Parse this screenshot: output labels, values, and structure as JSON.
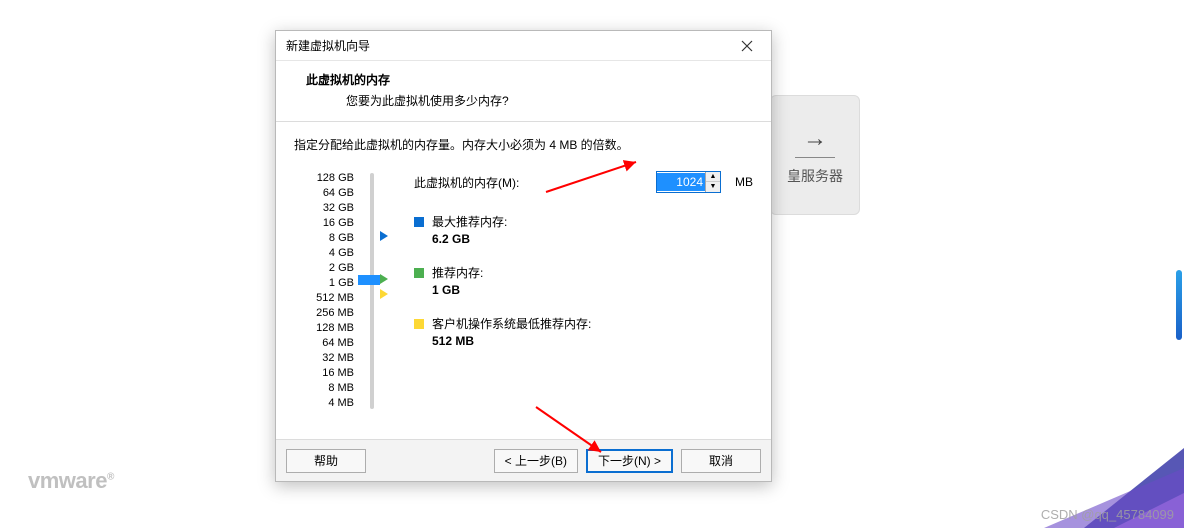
{
  "dialog": {
    "title": "新建虚拟机向导",
    "header_title": "此虚拟机的内存",
    "header_sub": "您要为此虚拟机使用多少内存?",
    "instruction": "指定分配给此虚拟机的内存量。内存大小必须为 4 MB 的倍数。",
    "mem_label": "此虚拟机的内存(M):",
    "mem_value": "1024",
    "mem_unit": "MB",
    "scale": [
      "128 GB",
      "64 GB",
      "32 GB",
      "16 GB",
      "8 GB",
      "4 GB",
      "2 GB",
      "1 GB",
      "512 MB",
      "256 MB",
      "128 MB",
      "64 MB",
      "32 MB",
      "16 MB",
      "8 MB",
      "4 MB"
    ],
    "legend": {
      "max": {
        "label": "最大推荐内存:",
        "value": "6.2 GB"
      },
      "rec": {
        "label": "推荐内存:",
        "value": "1 GB"
      },
      "min": {
        "label": "客户机操作系统最低推荐内存:",
        "value": "512 MB"
      }
    },
    "buttons": {
      "help": "帮助",
      "back": "< 上一步(B)",
      "next": "下一步(N) >",
      "cancel": "取消"
    }
  },
  "bg_card": {
    "label": "皇服务器"
  },
  "watermark": "CSDN @qq_45784099",
  "logo": "vmware"
}
